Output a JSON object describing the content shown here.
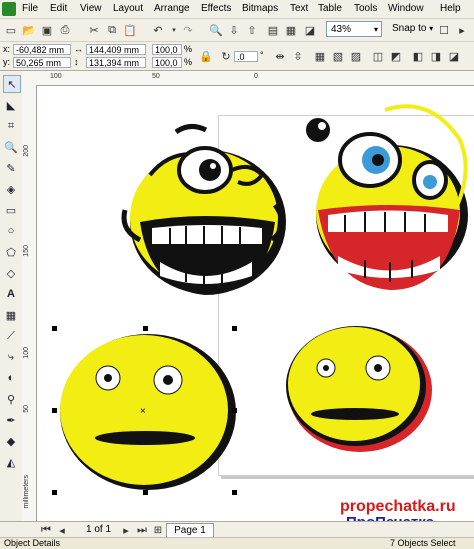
{
  "menu": {
    "items": [
      "File",
      "Edit",
      "View",
      "Layout",
      "Arrange",
      "Effects",
      "Bitmaps",
      "Text",
      "Table",
      "Tools",
      "Window",
      "Help"
    ]
  },
  "toolbar": {
    "zoom": "43%",
    "snap_label": "Snap to"
  },
  "propbar": {
    "x_label": "x:",
    "x_value": "-60,482 mm",
    "y_label": "y:",
    "y_value": "50,265 mm",
    "w_value": "144,409 mm",
    "h_value": "131,394 mm",
    "scale_w": "100,0",
    "scale_h": "100,0",
    "pct": "%",
    "angle": ".0",
    "angle_unit": "°"
  },
  "ruler": {
    "top_ticks": [
      "100",
      "50",
      "0"
    ],
    "left_ticks": [
      "200",
      "150",
      "100",
      "50"
    ],
    "unit": "millimeters"
  },
  "pagebar": {
    "page_count": "1 of 1",
    "page_tab": "Page 1"
  },
  "status": {
    "left": "Object Details",
    "right": "7 Objects Select"
  },
  "watermark": {
    "line1": "propechatka.ru",
    "line2": "ПроПечатка"
  },
  "colors": {
    "smiley_yellow": "#f2ee14",
    "outline": "#111111",
    "mouth_red": "#d7262a",
    "eye_blue": "#3a9bd8",
    "watermark_red": "#d81a1a",
    "watermark_blue": "#1b1bb8"
  }
}
